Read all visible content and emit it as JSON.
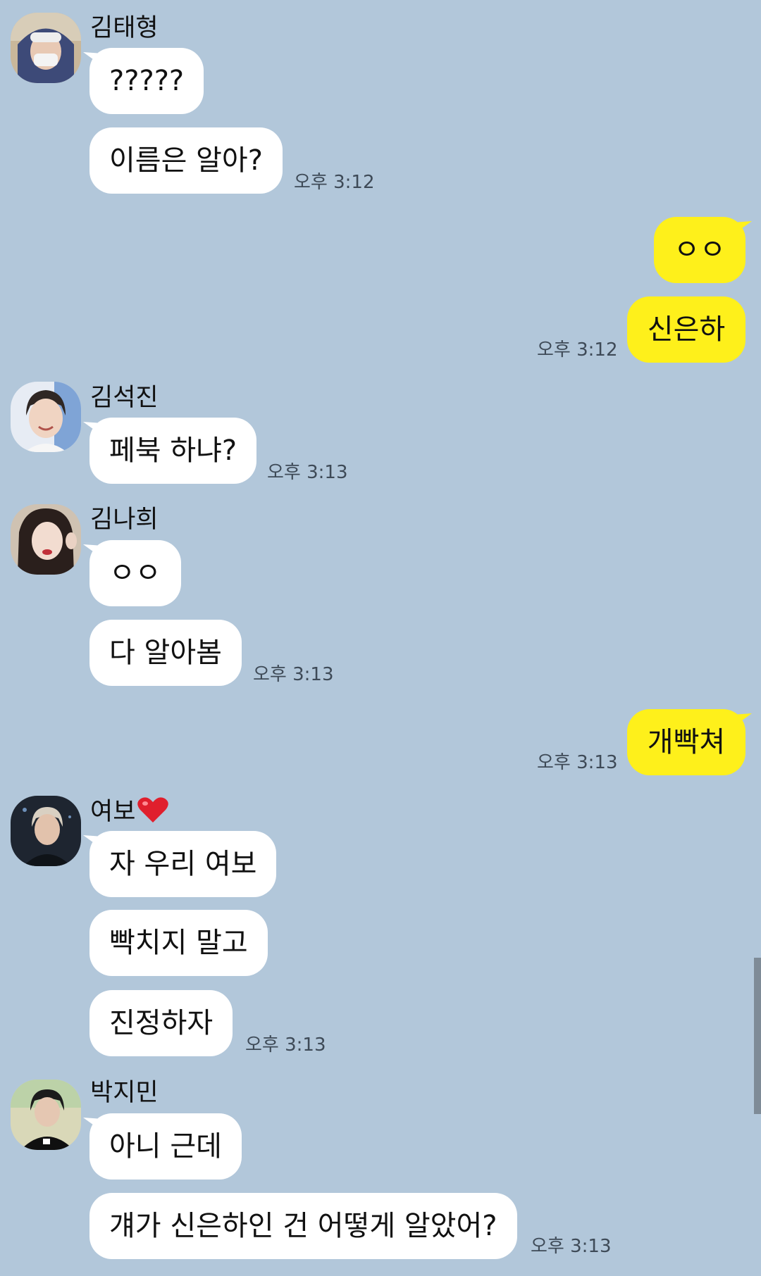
{
  "chat": {
    "bg_color": "#b2c7da",
    "incoming_bubble_color": "#ffffff",
    "outgoing_bubble_color": "#fef01b",
    "senders": [
      {
        "name": "김태형",
        "avatar": "person-avatar-hooded"
      },
      {
        "name": "김석진",
        "avatar": "person-avatar-smiling"
      },
      {
        "name": "김나희",
        "avatar": "person-avatar-woman"
      },
      {
        "name": "여보",
        "name_icon": "heart-icon",
        "avatar": "person-avatar-dark"
      },
      {
        "name": "박지민",
        "avatar": "person-avatar-black-tee"
      }
    ],
    "messages": {
      "m1": "?????",
      "m2": "이름은 알아?",
      "t1": "오후 3:12",
      "m3": "ㅇㅇ",
      "m4": "신은하",
      "t2": "오후 3:12",
      "m5": "페북 하냐?",
      "t3": "오후 3:13",
      "m6": "ㅇㅇ",
      "m7": "다 알아봄",
      "t4": "오후 3:13",
      "m8": "개빡쳐",
      "t5": "오후 3:13",
      "m9": "자 우리 여보",
      "m10": "빡치지 말고",
      "m11": "진정하자",
      "t6": "오후 3:13",
      "m12": "아니 근데",
      "m13": "걔가 신은하인 건 어떻게 알았어?",
      "t7": "오후 3:13"
    }
  }
}
